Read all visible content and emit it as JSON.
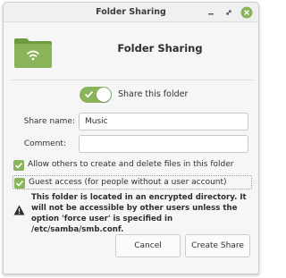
{
  "window": {
    "title": "Folder Sharing",
    "controls": [
      "minimize-icon",
      "maximize-icon",
      "close-icon"
    ],
    "close_color": "#8ab45a"
  },
  "header": {
    "icon": "folder-share-icon",
    "title": "Folder Sharing",
    "accent_color": "#8ab45a"
  },
  "share_toggle": {
    "label": "Share this folder",
    "on": true
  },
  "form": {
    "share_name_label": "Share name:",
    "share_name_value": "Music",
    "comment_label": "Comment:",
    "comment_value": ""
  },
  "options": {
    "allow_create_delete": {
      "label": "Allow others to create and delete files in this folder",
      "checked": true
    },
    "guest_access": {
      "label": "Guest access (for people without a user account)",
      "checked": true
    }
  },
  "warning": {
    "icon": "warning-icon",
    "text": "This folder is located in an encrypted directory. It will not be accessible by other users unless the option 'force user' is specified in /etc/samba/smb.conf."
  },
  "buttons": {
    "cancel": "Cancel",
    "create": "Create Share"
  }
}
